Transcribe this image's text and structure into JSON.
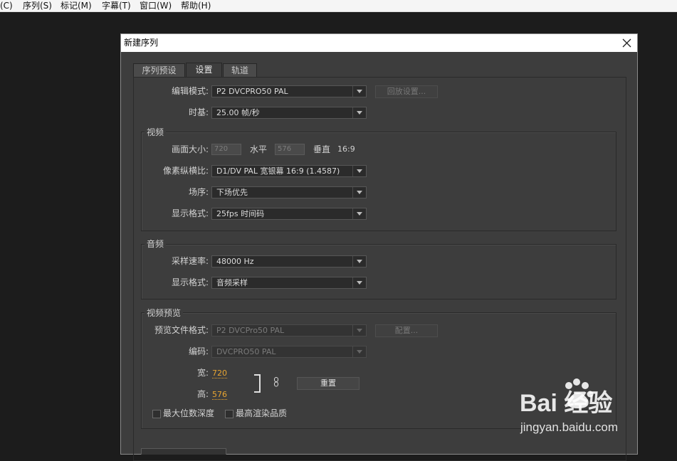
{
  "menubar": {
    "items": [
      "(C)",
      "序列(S)",
      "标记(M)",
      "字幕(T)",
      "窗口(W)",
      "帮助(H)"
    ]
  },
  "dialog": {
    "title": "新建序列",
    "tabs": [
      "序列预设",
      "设置",
      "轨道"
    ],
    "active_tab": "设置"
  },
  "settings": {
    "edit_mode_label": "编辑模式:",
    "edit_mode_value": "P2 DVCPRO50 PAL",
    "playback_button": "回放设置...",
    "timebase_label": "时基:",
    "timebase_value": "25.00 帧/秒"
  },
  "video": {
    "title": "视频",
    "frame_size_label": "画面大小:",
    "frame_width": "720",
    "horizontal_label": "水平",
    "frame_height": "576",
    "vertical_label": "垂直",
    "aspect_text": "16:9",
    "pixel_aspect_label": "像素纵横比:",
    "pixel_aspect_value": "D1/DV PAL 宽银幕 16:9 (1.4587)",
    "field_order_label": "场序:",
    "field_order_value": "下场优先",
    "display_format_label": "显示格式:",
    "display_format_value": "25fps 时间码"
  },
  "audio": {
    "title": "音频",
    "sample_rate_label": "采样速率:",
    "sample_rate_value": "48000 Hz",
    "display_format_label": "显示格式:",
    "display_format_value": "音频采样"
  },
  "preview": {
    "title": "视频预览",
    "file_format_label": "预览文件格式:",
    "file_format_value": "P2 DVCPro50 PAL",
    "configure_button": "配置...",
    "codec_label": "编码:",
    "codec_value": "DVCPRO50 PAL",
    "width_label": "宽:",
    "width_value": "720",
    "height_label": "高:",
    "height_value": "576",
    "reset_button": "重置",
    "max_bit_depth_label": "最大位数深度",
    "max_render_quality_label": "最高渲染品质"
  },
  "watermark": {
    "brand": "Bai 经验",
    "url": "jingyan.baidu.com"
  },
  "colors": {
    "dialog_bg": "#3d3d3d",
    "accent_value": "#e8a531",
    "desktop_bg": "#1c1c1c"
  }
}
